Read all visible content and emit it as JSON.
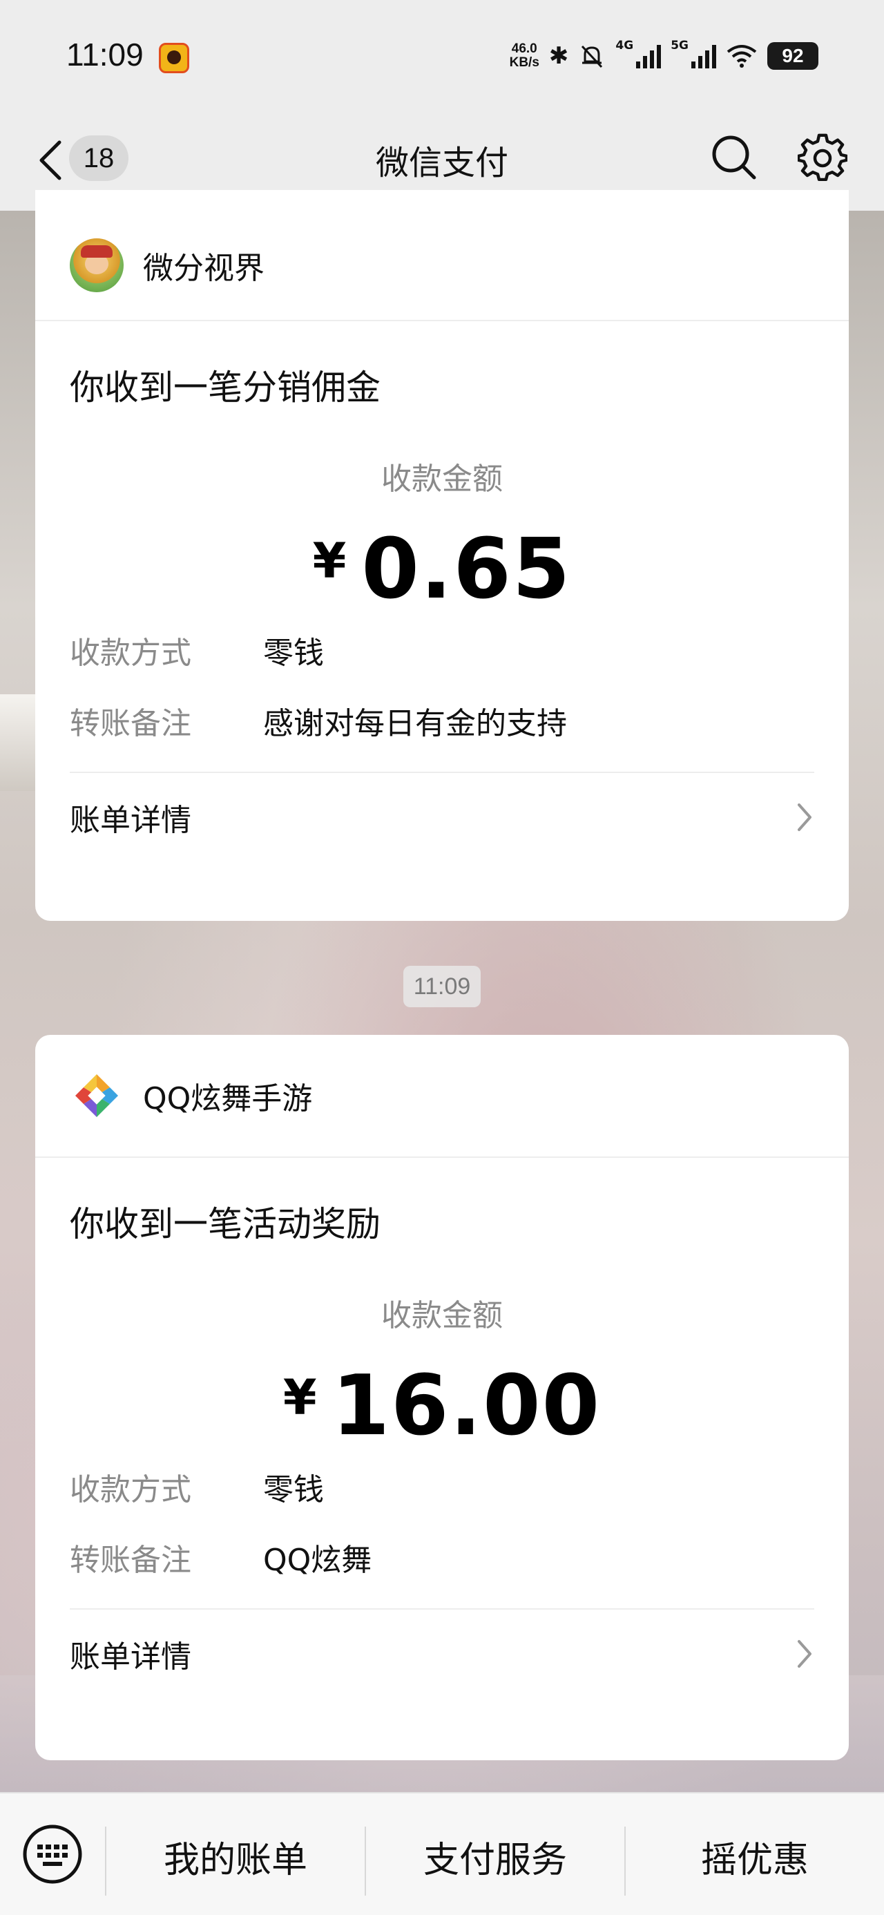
{
  "status_bar": {
    "time": "11:09",
    "speed_value": "46.0",
    "speed_unit": "KB/s",
    "net_4g": "4G",
    "net_5g": "5G",
    "battery": "92"
  },
  "nav": {
    "unread_count": "18",
    "title": "微信支付"
  },
  "messages": [
    {
      "sender": "微分视界",
      "title": "你收到一笔分销佣金",
      "amount_label": "收款金额",
      "currency": "¥",
      "amount": "0.65",
      "method_label": "收款方式",
      "method_value": "零钱",
      "note_label": "转账备注",
      "note_value": "感谢对每日有金的支持",
      "detail_label": "账单详情"
    },
    {
      "sender": "QQ炫舞手游",
      "title": "你收到一笔活动奖励",
      "amount_label": "收款金额",
      "currency": "¥",
      "amount": "16.00",
      "method_label": "收款方式",
      "method_value": "零钱",
      "note_label": "转账备注",
      "note_value": "QQ炫舞",
      "detail_label": "账单详情"
    }
  ],
  "timestamp": "11:09",
  "bottom_menu": {
    "items": [
      "我的账单",
      "支付服务",
      "摇优惠"
    ]
  },
  "icons": {
    "back": "chevron-left-icon",
    "search": "search-icon",
    "settings": "gear-icon",
    "keyboard": "keyboard-icon",
    "chevron": "chevron-right-icon"
  },
  "colors": {
    "background": "#ededed",
    "card": "#ffffff",
    "secondary_text": "#8a8a8a"
  }
}
